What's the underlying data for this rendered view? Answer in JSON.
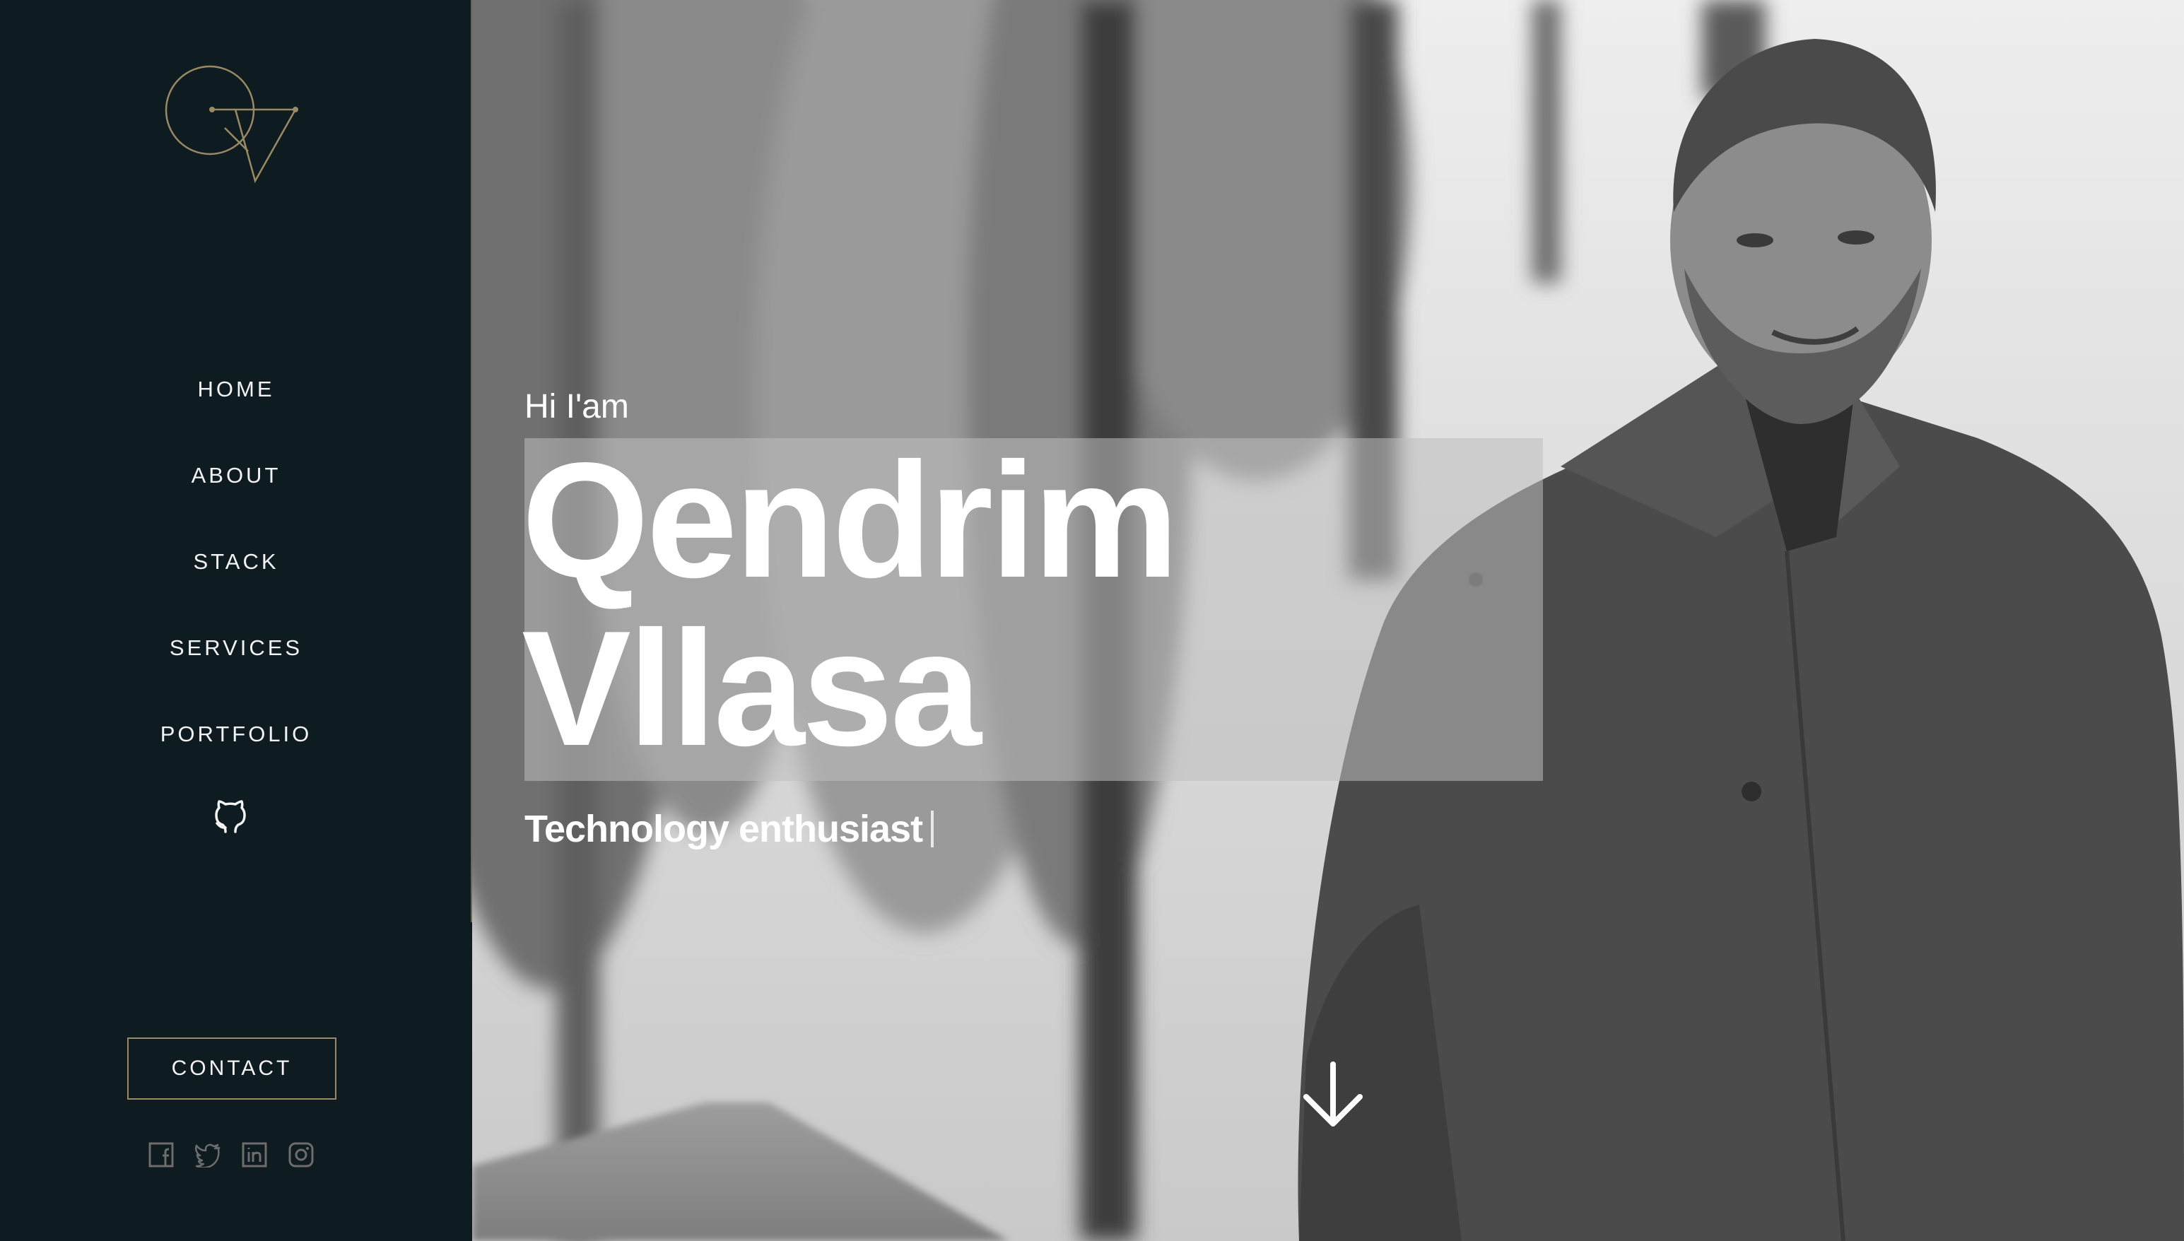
{
  "sidebar": {
    "logo": {
      "icon": "qv-monogram-logo",
      "color": "#9a8a63"
    },
    "nav": [
      {
        "label": "HOME"
      },
      {
        "label": "ABOUT"
      },
      {
        "label": "STACK"
      },
      {
        "label": "SERVICES"
      },
      {
        "label": "PORTFOLIO"
      }
    ],
    "github_icon": "github-icon",
    "contact_label": "CONTACT",
    "socials": [
      "facebook-icon",
      "twitter-icon",
      "linkedin-icon",
      "instagram-icon"
    ]
  },
  "hero": {
    "greeting": "Hi I'am",
    "name_line1": "Qendrim",
    "name_line2": "Vllasa",
    "tagline": "Technology enthusiast",
    "scroll_icon": "arrow-down-icon"
  },
  "colors": {
    "sidebar_bg": "#0e1b20",
    "accent_gold": "#9a8a63",
    "text": "#ffffff"
  }
}
